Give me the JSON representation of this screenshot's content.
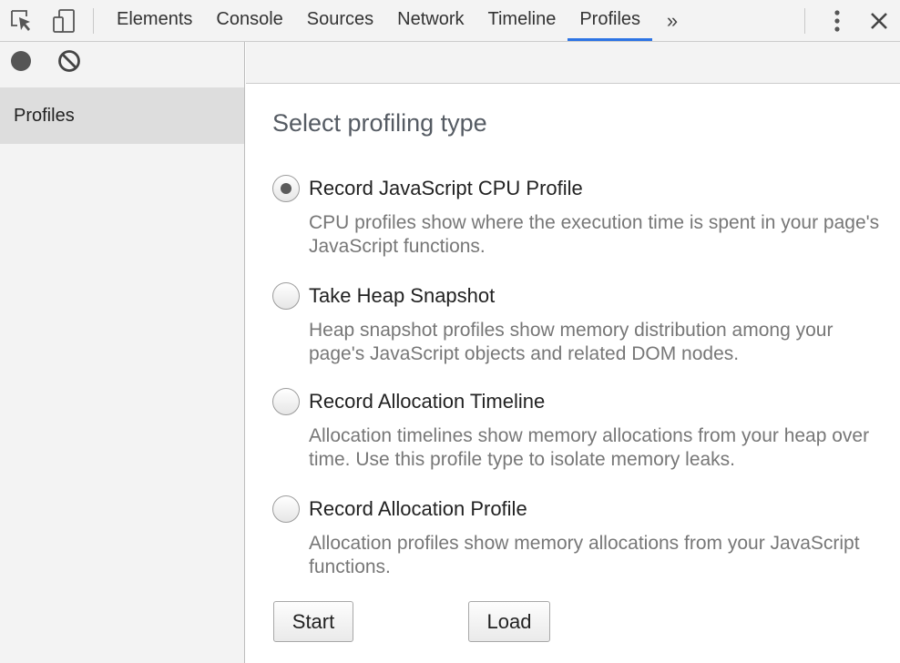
{
  "tabs": [
    {
      "label": "Elements"
    },
    {
      "label": "Console"
    },
    {
      "label": "Sources"
    },
    {
      "label": "Network"
    },
    {
      "label": "Timeline"
    },
    {
      "label": "Profiles",
      "active": true
    }
  ],
  "more_tabs": "»",
  "sidebar": {
    "items": [
      {
        "label": "Profiles"
      }
    ]
  },
  "main": {
    "title": "Select profiling type",
    "options": [
      {
        "label": "Record JavaScript CPU Profile",
        "description": "CPU profiles show where the execution time is spent in your page's JavaScript functions.",
        "checked": true
      },
      {
        "label": "Take Heap Snapshot",
        "description": "Heap snapshot profiles show memory distribution among your page's JavaScript objects and related DOM nodes.",
        "checked": false
      },
      {
        "label": "Record Allocation Timeline",
        "description": "Allocation timelines show memory allocations from your heap over time. Use this profile type to isolate memory leaks.",
        "checked": false
      },
      {
        "label": "Record Allocation Profile",
        "description": "Allocation profiles show memory allocations from your JavaScript functions.",
        "checked": false
      }
    ],
    "start_label": "Start",
    "load_label": "Load"
  },
  "icons": {
    "inspect": "inspect-element-icon",
    "device": "device-toolbar-icon",
    "menu": "kebab-menu-icon",
    "close": "close-icon",
    "record": "record-icon",
    "clear": "clear-icon"
  },
  "colors": {
    "active_tab_underline": "#2d74e4",
    "sidebar_selected": "#dddddd",
    "toolbar_bg": "#f3f3f3"
  }
}
